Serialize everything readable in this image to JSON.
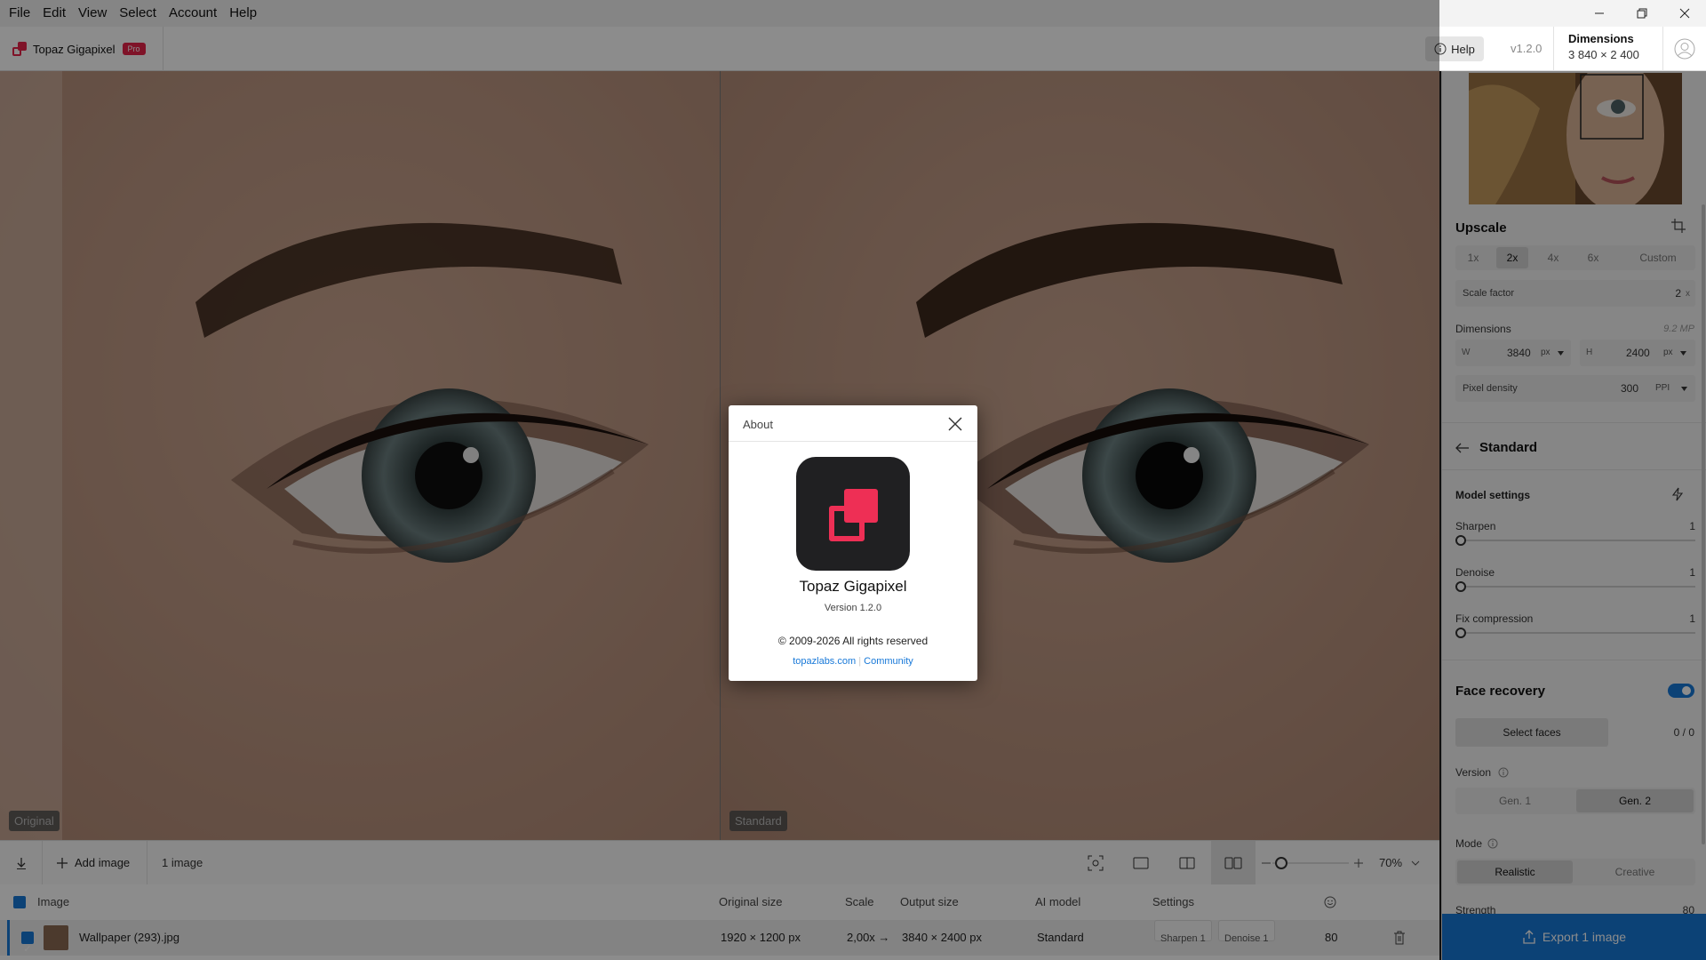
{
  "menubar": {
    "items": [
      "File",
      "Edit",
      "View",
      "Select",
      "Account",
      "Help"
    ]
  },
  "header": {
    "app_name": "Topaz Gigapixel",
    "badge": "Pro",
    "help_label": "Help",
    "version": "v1.2.0",
    "dimensions_title": "Dimensions",
    "dimensions_value": "3 840 × 2 400"
  },
  "viewer": {
    "left_label": "Original",
    "right_label": "Standard"
  },
  "toolbar": {
    "add_image": "Add image",
    "image_count": "1 image",
    "zoom": "70%"
  },
  "file_list": {
    "headers": [
      "Image",
      "Original size",
      "Scale",
      "Output size",
      "AI model",
      "Settings"
    ],
    "row": {
      "name": "Wallpaper (293).jpg",
      "original_size": "1920 × 1200 px",
      "scale": "2,00x →",
      "output_size": "3840 × 2400 px",
      "model": "Standard",
      "chip_sharpen": "Sharpen 1",
      "chip_denoise": "Denoise 1",
      "score": "80"
    }
  },
  "sidebar": {
    "upscale_title": "Upscale",
    "scale_options": [
      "1x",
      "2x",
      "4x",
      "6x",
      "Custom"
    ],
    "scale_selected": "2x",
    "scale_factor_label": "Scale factor",
    "scale_factor_value": "2",
    "scale_factor_unit": "x",
    "dimensions_label": "Dimensions",
    "megapixels": "9.2 MP",
    "w_label": "W",
    "w_value": "3840",
    "h_label": "H",
    "h_value": "2400",
    "unit": "px",
    "density_label": "Pixel density",
    "density_value": "300",
    "density_unit": "PPI",
    "model_name": "Standard",
    "model_settings_title": "Model settings",
    "sliders": [
      {
        "label": "Sharpen",
        "value": "1"
      },
      {
        "label": "Denoise",
        "value": "1"
      },
      {
        "label": "Fix compression",
        "value": "1"
      }
    ],
    "face_recovery_title": "Face recovery",
    "face_recovery_on": true,
    "select_faces": "Select faces",
    "faces_count": "0 / 0",
    "version_label": "Version",
    "version_options": [
      "Gen. 1",
      "Gen. 2"
    ],
    "version_selected": "Gen. 2",
    "mode_label": "Mode",
    "mode_options": [
      "Realistic",
      "Creative"
    ],
    "mode_selected": "Realistic",
    "strength_label": "Strength",
    "strength_value": "80",
    "export_label": "Export 1 image"
  },
  "about": {
    "title": "About",
    "app_name": "Topaz Gigapixel",
    "version": "Version 1.2.0",
    "copyright": "© 2009-2026 All rights reserved",
    "link1": "topazlabs.com",
    "link2": "Community"
  },
  "colors": {
    "accent_red": "#e8234a",
    "accent_blue": "#1778d8"
  }
}
